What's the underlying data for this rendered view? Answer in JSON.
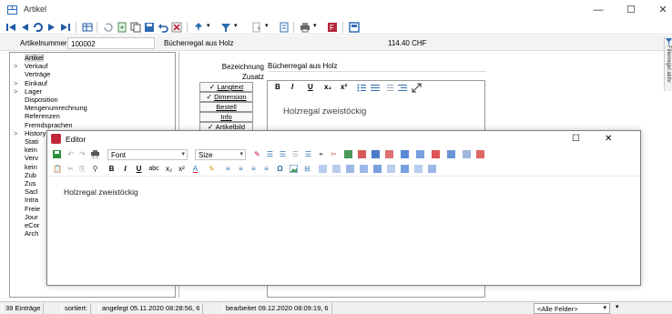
{
  "window": {
    "title": "Artikel",
    "minimize": "—",
    "maximize": "☐",
    "close": "✕"
  },
  "record": {
    "artnr_label": "Artikelnummer",
    "artnr_value": "100002",
    "name": "Bücherregal aus Holz",
    "price": "114.40 CHF"
  },
  "tree": {
    "items": [
      {
        "label": "Artikel",
        "exp": "",
        "selected": true
      },
      {
        "label": "Verkauf",
        "exp": ">"
      },
      {
        "label": "Verträge",
        "exp": ""
      },
      {
        "label": "Einkauf",
        "exp": ">"
      },
      {
        "label": "Lager",
        "exp": ">"
      },
      {
        "label": "Disposition",
        "exp": ""
      },
      {
        "label": "Mengenumrechnung",
        "exp": ""
      },
      {
        "label": "Referenzen",
        "exp": ""
      },
      {
        "label": "Fremdsprachen",
        "exp": ""
      },
      {
        "label": "History",
        "exp": ">"
      },
      {
        "label": "Stati",
        "exp": ""
      },
      {
        "label": "kein",
        "exp": ""
      },
      {
        "label": "Verv",
        "exp": ""
      },
      {
        "label": "kein",
        "exp": ""
      },
      {
        "label": "Zub",
        "exp": ""
      },
      {
        "label": "Zus",
        "exp": ""
      },
      {
        "label": "Sacl",
        "exp": ""
      },
      {
        "label": "Intra",
        "exp": ""
      },
      {
        "label": "Freie",
        "exp": ""
      },
      {
        "label": "Jour",
        "exp": ""
      },
      {
        "label": "eCor",
        "exp": ""
      },
      {
        "label": "Arch",
        "exp": ""
      }
    ]
  },
  "form": {
    "bezeichnung_label": "Bezeichnung",
    "bezeichnung_value": "Bücherregal aus Holz",
    "zusatz_label": "Zusatz",
    "buttons": {
      "langtext": "Langtext",
      "dimension": "Dimension",
      "bestell": "Bestell",
      "info": "Info",
      "artikelbild": "Artikelbild"
    },
    "checkmark": "✓",
    "mini_editor_text": "Holzregal zweistöckig",
    "mini_editor_tools": [
      "B",
      "I",
      "U",
      "x₂",
      "x²"
    ]
  },
  "side_tab": {
    "label": "Filterregel aktiv"
  },
  "editor": {
    "title": "Editor",
    "font_combo": "Font",
    "size_combo": "Size",
    "tools_row2": [
      "B",
      "I",
      "U",
      "abc",
      "x₂",
      "x²"
    ],
    "content": "Holzregal zweistöckig",
    "maximize": "☐",
    "close": "✕"
  },
  "status": {
    "entries": "39 Einträge",
    "sorted": "sortiert:",
    "created": "angelegt 05.11.2020 08:28:56, 6",
    "edited": "bearbeitet 09.12.2020 08:09:19, 6",
    "filter": "<Alle Felder>"
  },
  "colors": {
    "accent_blue": "#1f5aa6",
    "editor_icon_red": "#c0283a",
    "dialog_border": "#7e7e7e"
  }
}
